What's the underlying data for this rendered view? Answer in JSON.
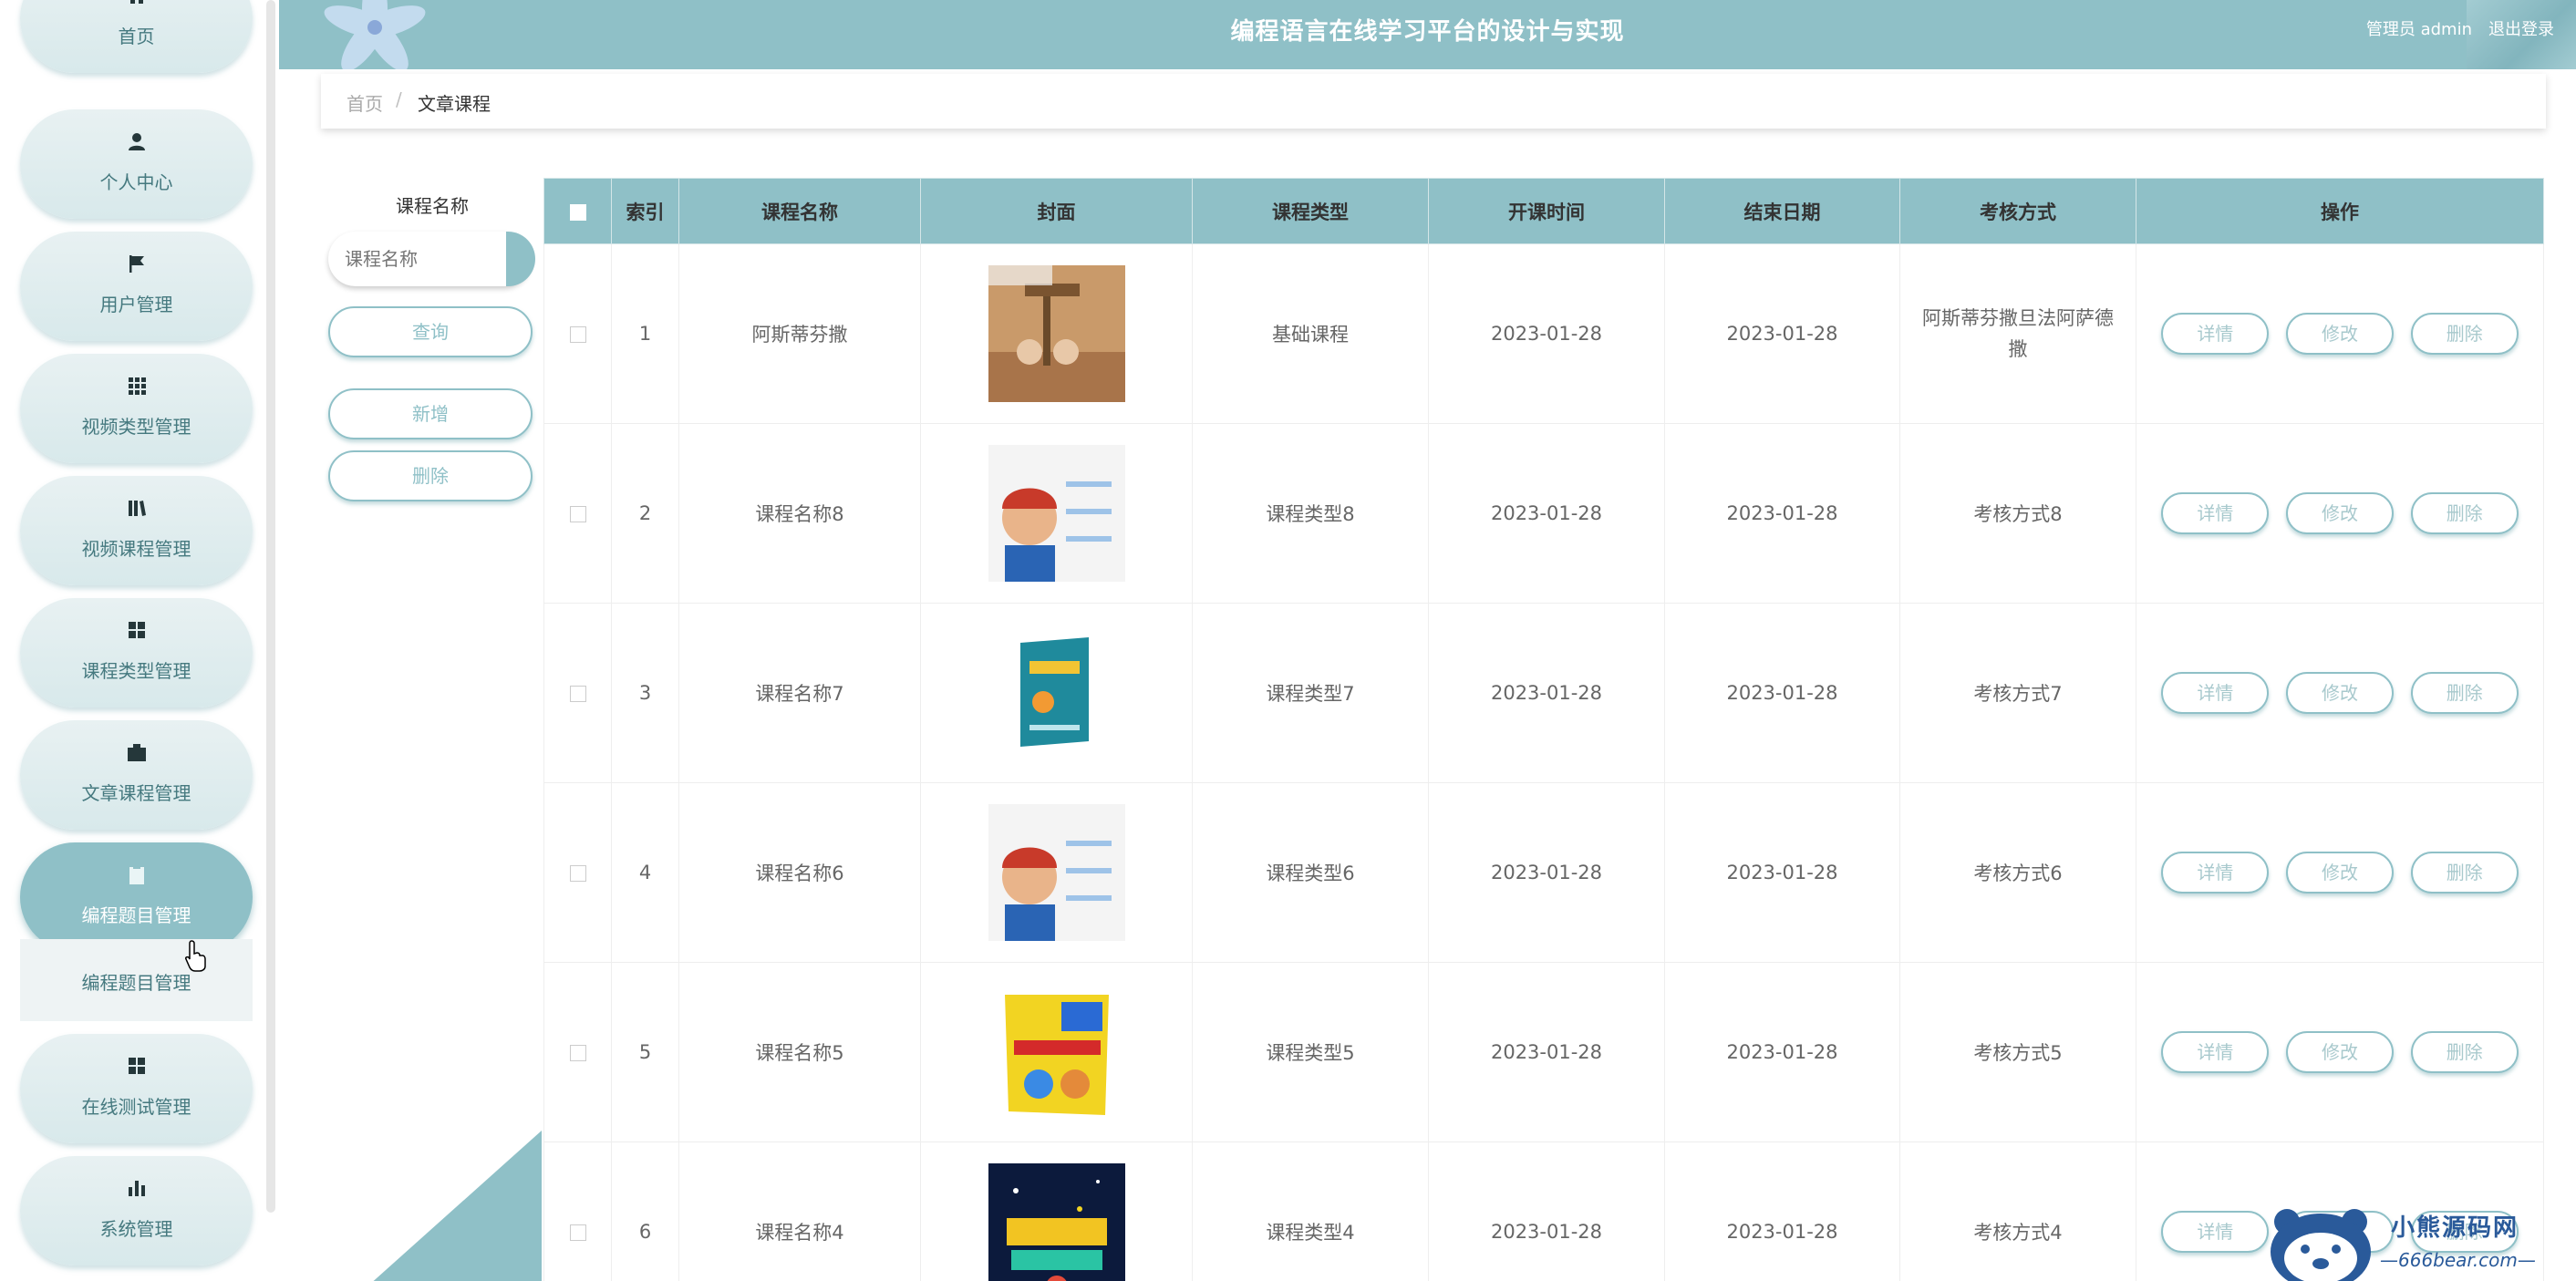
{
  "app": {
    "title": "编程语言在线学习平台的设计与实现",
    "user_label": "管理员 admin",
    "logout_label": "退出登录"
  },
  "sidebar": {
    "items": [
      {
        "label": "首页",
        "icon": "home-icon"
      },
      {
        "label": "个人中心",
        "icon": "user-icon"
      },
      {
        "label": "用户管理",
        "icon": "flag-icon"
      },
      {
        "label": "视频类型管理",
        "icon": "grid-icon"
      },
      {
        "label": "视频课程管理",
        "icon": "book-icon"
      },
      {
        "label": "课程类型管理",
        "icon": "apps-icon"
      },
      {
        "label": "文章课程管理",
        "icon": "briefcase-icon"
      },
      {
        "label": "编程题目管理",
        "icon": "clipboard-icon",
        "active": true
      },
      {
        "label": "在线测试管理",
        "icon": "apps-icon"
      },
      {
        "label": "系统管理",
        "icon": "bar-chart-icon"
      }
    ],
    "submenu": {
      "label": "编程题目管理"
    }
  },
  "breadcrumb": {
    "home": "首页",
    "separator": "/",
    "current": "文章课程"
  },
  "search": {
    "label": "课程名称",
    "placeholder": "课程名称",
    "query_button": "查询",
    "add_button": "新增",
    "delete_button": "删除"
  },
  "table": {
    "headers": [
      "索引",
      "课程名称",
      "封面",
      "课程类型",
      "开课时间",
      "结束日期",
      "考核方式",
      "操作"
    ],
    "rows": [
      {
        "index": "1",
        "name": "阿斯蒂芬撒",
        "type": "基础课程",
        "start": "2023-01-28",
        "end": "2023-01-28",
        "assessment": "阿斯蒂芬撒旦法阿萨德撒",
        "cover": "desk-lamp-figurines"
      },
      {
        "index": "2",
        "name": "课程名称8",
        "type": "课程类型8",
        "start": "2023-01-28",
        "end": "2023-01-28",
        "assessment": "考核方式8",
        "cover": "kid-coder-poster"
      },
      {
        "index": "3",
        "name": "课程名称7",
        "type": "课程类型7",
        "start": "2023-01-28",
        "end": "2023-01-28",
        "assessment": "考核方式7",
        "cover": "scratch-book-teal"
      },
      {
        "index": "4",
        "name": "课程名称6",
        "type": "课程类型6",
        "start": "2023-01-28",
        "end": "2023-01-28",
        "assessment": "考核方式6",
        "cover": "kid-coder-poster"
      },
      {
        "index": "5",
        "name": "课程名称5",
        "type": "课程类型5",
        "start": "2023-01-28",
        "end": "2023-01-28",
        "assessment": "考核方式5",
        "cover": "cpp-book-yellow"
      },
      {
        "index": "6",
        "name": "课程名称4",
        "type": "课程类型4",
        "start": "2023-01-28",
        "end": "2023-01-28",
        "assessment": "考核方式4",
        "cover": "kids-coding-space"
      }
    ],
    "actions": {
      "detail": "详情",
      "edit": "修改",
      "delete": "删除"
    }
  },
  "watermark": {
    "name": "小熊源码网",
    "site": "—666bear.com—"
  },
  "colors": {
    "accent": "#8fc0c7",
    "header_bg": "#8fc0c7",
    "sidebar_text": "#45797f"
  }
}
